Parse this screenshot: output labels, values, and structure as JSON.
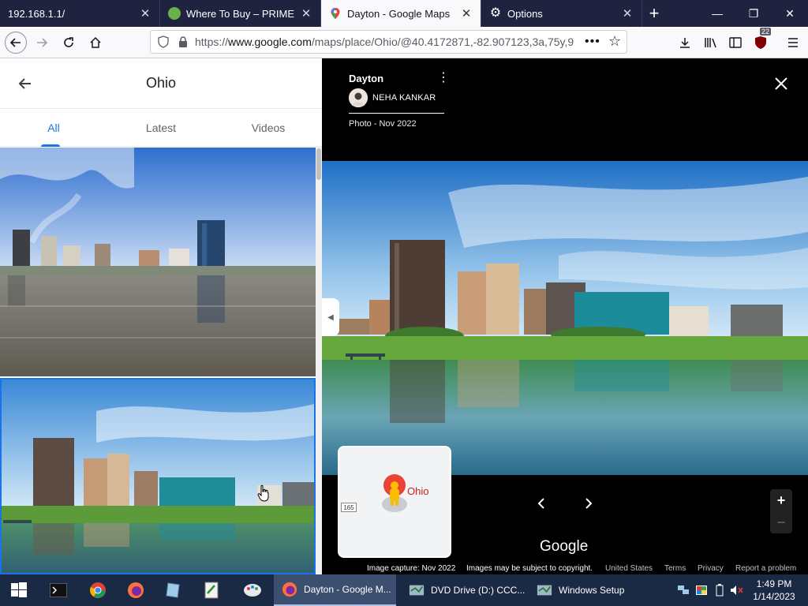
{
  "browser": {
    "tabs": [
      {
        "title": "192.168.1.1/",
        "active": false
      },
      {
        "title": "Where To Buy – PRIME",
        "active": false
      },
      {
        "title": "Dayton - Google Maps",
        "active": true
      },
      {
        "title": "Options",
        "active": false
      }
    ],
    "url_prefix": "https://",
    "url_domain": "www.google.com",
    "url_rest": "/maps/place/Ohio/@40.4172871,-82.907123,3a,75y,9",
    "badge_count": "22",
    "new_tab_label": "+"
  },
  "panel": {
    "title": "Ohio",
    "tabs": [
      "All",
      "Latest",
      "Videos"
    ],
    "active_tab": "All"
  },
  "viewer": {
    "place": "Dayton",
    "author": "NEHA KANKAR",
    "photo_date": "Photo - Nov 2022",
    "minimap_label": "Ohio",
    "route_number": "165",
    "google_logo": "Google",
    "image_capture": "Image capture: Nov 2022",
    "copyright": "Images may be subject to copyright.",
    "footer_links": [
      "United States",
      "Terms",
      "Privacy",
      "Report a problem"
    ]
  },
  "taskbar": {
    "tasks": [
      {
        "label": "Dayton - Google M...",
        "active": true
      },
      {
        "label": "DVD Drive (D:) CCC...",
        "active": false
      },
      {
        "label": "Windows Setup",
        "active": false
      }
    ],
    "time": "1:49 PM",
    "date": "1/14/2023"
  },
  "colors": {
    "tabbar_bg": "#202340",
    "accent_blue": "#1a73e8",
    "taskbar_bg": "#1b2a44"
  },
  "icons": [
    "back-icon",
    "forward-icon",
    "reload-icon",
    "home-icon",
    "shield-icon",
    "lock-icon",
    "more-icon",
    "star-icon",
    "download-icon",
    "library-icon",
    "sidebar-icon",
    "ublock-icon",
    "menu-icon",
    "close-icon",
    "kebab-icon",
    "chevron-left-icon",
    "chevron-right-icon",
    "zoom-in-icon",
    "zoom-out-icon",
    "pegman-icon",
    "start-icon"
  ]
}
